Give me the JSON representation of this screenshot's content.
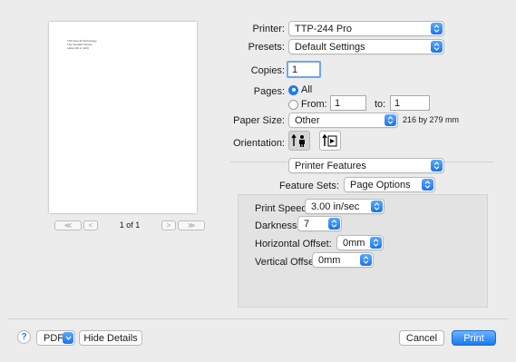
{
  "preview": {
    "text_lines": [
      "TSC Auto ID Technology",
      "The Versatile Choice",
      "Label 4x6 in (4x6)"
    ],
    "page_indicator": "1 of 1",
    "first_label": "≪",
    "prev_label": "<",
    "next_label": ">",
    "last_label": "≫"
  },
  "printer": {
    "label": "Printer:",
    "value": "TTP-244 Pro"
  },
  "presets": {
    "label": "Presets:",
    "value": "Default Settings"
  },
  "copies": {
    "label": "Copies:",
    "value": "1"
  },
  "pages": {
    "label": "Pages:",
    "all_label": "All",
    "from_label": "From:",
    "from_value": "1",
    "to_label": "to:",
    "to_value": "1"
  },
  "paper_size": {
    "label": "Paper Size:",
    "value": "Other",
    "dimensions": "216 by 279 mm"
  },
  "orientation": {
    "label": "Orientation:"
  },
  "section_select": {
    "value": "Printer Features"
  },
  "feature_sets": {
    "label": "Feature Sets:",
    "value": "Page Options"
  },
  "features": {
    "print_speed": {
      "label": "Print Speed:",
      "value": "3.00 in/sec"
    },
    "darkness": {
      "label": "Darkness:",
      "value": "7"
    },
    "horizontal_offset": {
      "label": "Horizontal Offset:",
      "value": "0mm"
    },
    "vertical_offset": {
      "label": "Vertical Offset:",
      "value": "0mm"
    }
  },
  "footer": {
    "help_label": "?",
    "pdf_label": "PDF",
    "hide_details_label": "Hide Details",
    "cancel_label": "Cancel",
    "print_label": "Print"
  },
  "colors": {
    "accent": "#1f7bf0",
    "background": "#ececec",
    "panel": "#e3e3e3"
  }
}
